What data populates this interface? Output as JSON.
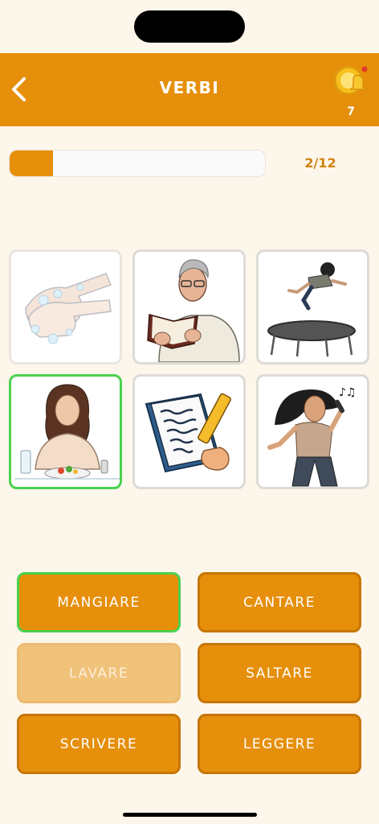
{
  "header": {
    "title": "VERBI",
    "coin_count": "7",
    "background": "#e68f0b"
  },
  "icons": {
    "back": "chevron-left-icon",
    "coins": "coin-bell-icon"
  },
  "progress": {
    "current": 2,
    "total": 12,
    "fraction": 0.17,
    "label": "2/12"
  },
  "pictures": [
    {
      "name": "washing-hands-picture",
      "state": "faded"
    },
    {
      "name": "reading-man-picture",
      "state": "default"
    },
    {
      "name": "trampoline-jump-picture",
      "state": "default"
    },
    {
      "name": "eating-woman-picture",
      "state": "selected"
    },
    {
      "name": "writing-notebook-picture",
      "state": "default"
    },
    {
      "name": "singing-woman-picture",
      "state": "default"
    }
  ],
  "answers": [
    {
      "label": "MANGIARE",
      "state": "selected"
    },
    {
      "label": "CANTARE",
      "state": "default"
    },
    {
      "label": "LAVARE",
      "state": "used"
    },
    {
      "label": "SALTARE",
      "state": "default"
    },
    {
      "label": "SCRIVERE",
      "state": "default"
    },
    {
      "label": "LEGGERE",
      "state": "default"
    }
  ],
  "colors": {
    "accent": "#e68f0b",
    "selected_border": "#4ad14e",
    "background": "#fdf6ea"
  }
}
